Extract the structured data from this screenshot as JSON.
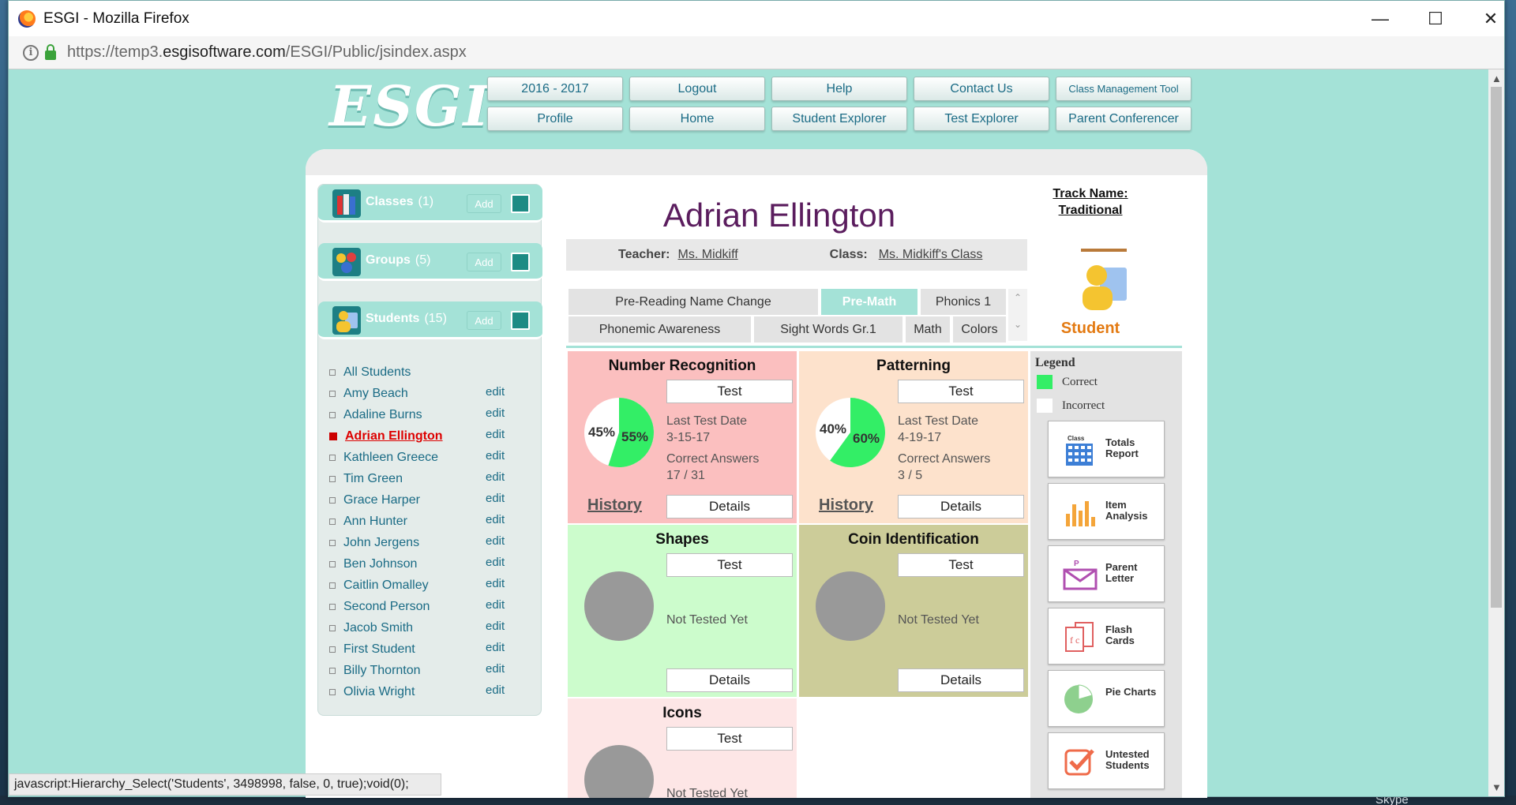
{
  "window": {
    "title": "ESGI - Mozilla Firefox"
  },
  "address": {
    "prefix": "https://temp3.",
    "domain": "esgisoftware.com",
    "path": "/ESGI/Public/jsindex.aspx"
  },
  "logo": "ESGI",
  "nav": {
    "year": "2016 - 2017",
    "logout": "Logout",
    "help": "Help",
    "contact": "Contact Us",
    "class_tool": "Class Management Tool",
    "profile": "Profile",
    "home": "Home",
    "student_explorer": "Student Explorer",
    "test_explorer": "Test Explorer",
    "parent_conferencer": "Parent Conferencer"
  },
  "sidebar": {
    "classes": {
      "label": "Classes",
      "count": "(1)",
      "add": "Add"
    },
    "groups": {
      "label": "Groups",
      "count": "(5)",
      "add": "Add"
    },
    "students": {
      "label": "Students",
      "count": "(15)",
      "add": "Add"
    },
    "all_students": "All Students",
    "edit_label": "edit",
    "items": [
      {
        "name": "Amy Beach"
      },
      {
        "name": "Adaline Burns"
      },
      {
        "name": "Adrian Ellington"
      },
      {
        "name": "Kathleen Greece"
      },
      {
        "name": "Tim Green"
      },
      {
        "name": "Grace Harper"
      },
      {
        "name": "Ann Hunter"
      },
      {
        "name": "John Jergens"
      },
      {
        "name": "Ben Johnson"
      },
      {
        "name": "Caitlin Omalley"
      },
      {
        "name": "Second Person"
      },
      {
        "name": "Jacob Smith"
      },
      {
        "name": "First Student"
      },
      {
        "name": "Billy Thornton"
      },
      {
        "name": "Olivia Wright"
      }
    ],
    "selected_index": 2
  },
  "student": {
    "name": "Adrian Ellington",
    "teacher_label": "Teacher:",
    "teacher": "Ms. Midkiff",
    "class_label": "Class:",
    "class": "Ms. Midkiff's Class",
    "role_label": "Student"
  },
  "track": {
    "line1": "Track Name:",
    "line2": "Traditional"
  },
  "tabs": {
    "row1": [
      "Pre-Reading Name Change",
      "Pre-Math",
      "Phonics 1"
    ],
    "row2": [
      "Phonemic Awareness",
      "Sight Words Gr.1",
      "Math",
      "Colors"
    ],
    "active": "Pre-Math"
  },
  "cards": {
    "test_label": "Test",
    "details_label": "Details",
    "history_label": "History",
    "last_test_label": "Last Test Date",
    "correct_label": "Correct Answers",
    "not_tested": "Not Tested Yet",
    "number_recognition": {
      "title": "Number Recognition",
      "date": "3-15-17",
      "answers": "17 / 31",
      "pct_incorrect": "45%",
      "pct_correct": "55%",
      "fraction": 0.55
    },
    "patterning": {
      "title": "Patterning",
      "date": "4-19-17",
      "answers": "3 / 5",
      "pct_incorrect": "40%",
      "pct_correct": "60%",
      "fraction": 0.6
    },
    "shapes": {
      "title": "Shapes"
    },
    "coin": {
      "title": "Coin Identification"
    },
    "icons": {
      "title": "Icons"
    }
  },
  "legend": {
    "title": "Legend",
    "correct": "Correct",
    "incorrect": "Incorrect",
    "correct_color": "#33ee66",
    "reports": [
      {
        "label": "Totals Report",
        "badge": "Class"
      },
      {
        "label": "Item Analysis"
      },
      {
        "label": "Parent Letter",
        "badge": "P"
      },
      {
        "label": "Flash Cards",
        "badge": "f c"
      },
      {
        "label": "Pie Charts"
      },
      {
        "label": "Untested Students"
      }
    ]
  },
  "status": "javascript:Hierarchy_Select('Students', 3498998, false, 0, true);void(0);",
  "taskbar": {
    "skype": "Skype"
  },
  "colors": {
    "accent": "#a4e2d7",
    "brand_text": "#1a6b85",
    "name": "#5b1d5e",
    "selected": "#d00000"
  }
}
